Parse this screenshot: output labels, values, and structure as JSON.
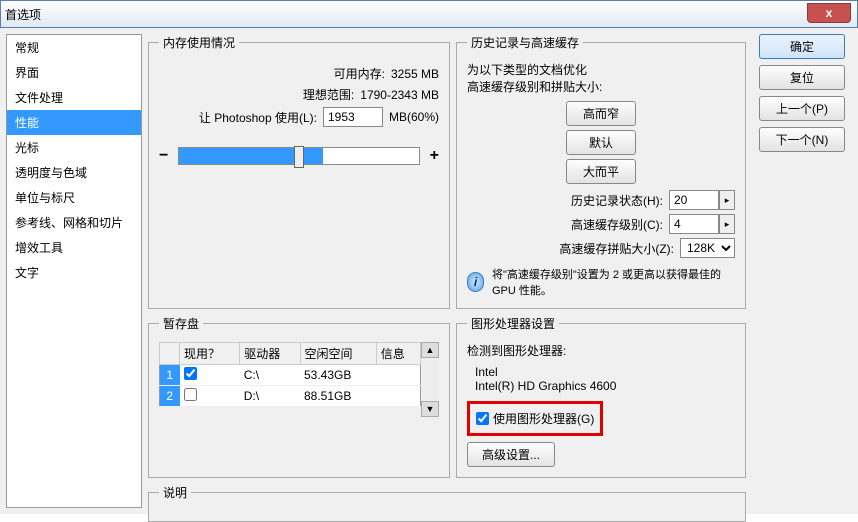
{
  "window": {
    "title": "首选项"
  },
  "sidebar": {
    "items": [
      "常规",
      "界面",
      "文件处理",
      "性能",
      "光标",
      "透明度与色域",
      "单位与标尺",
      "参考线、网格和切片",
      "增效工具",
      "文字"
    ],
    "active_index": 3
  },
  "buttons": {
    "ok": "确定",
    "reset": "复位",
    "prev": "上一个(P)",
    "next": "下一个(N)"
  },
  "memory": {
    "legend": "内存使用情况",
    "available_label": "可用内存:",
    "available_value": "3255 MB",
    "ideal_label": "理想范围:",
    "ideal_value": "1790-2343 MB",
    "use_label": "让 Photoshop 使用(L):",
    "use_value": "1953",
    "use_suffix": "MB(60%)"
  },
  "history": {
    "legend": "历史记录与高速缓存",
    "opt_hint1": "为以下类型的文档优化",
    "opt_hint2": "高速缓存级别和拼贴大小:",
    "btn_tall": "高而窄",
    "btn_default": "默认",
    "btn_big": "大而平",
    "states_label": "历史记录状态(H):",
    "states_value": "20",
    "levels_label": "高速缓存级别(C):",
    "levels_value": "4",
    "tile_label": "高速缓存拼贴大小(Z):",
    "tile_value": "128K",
    "tip": "将\"高速缓存级别\"设置为 2 或更高以获得最佳的 GPU 性能。"
  },
  "scratch": {
    "legend": "暂存盘",
    "cols": {
      "active": "现用？",
      "drive": "驱动器",
      "free": "空闲空间",
      "info": "信息"
    },
    "rows": [
      {
        "num": "1",
        "active": true,
        "drive": "C:\\",
        "free": "53.43GB",
        "info": ""
      },
      {
        "num": "2",
        "active": false,
        "drive": "D:\\",
        "free": "88.51GB",
        "info": ""
      }
    ]
  },
  "gpu": {
    "legend": "图形处理器设置",
    "detected_label": "检测到图形处理器:",
    "vendor": "Intel",
    "model": "Intel(R) HD Graphics 4600",
    "use_label": "使用图形处理器(G)",
    "advanced": "高级设置..."
  },
  "desc": {
    "legend": "说明"
  }
}
